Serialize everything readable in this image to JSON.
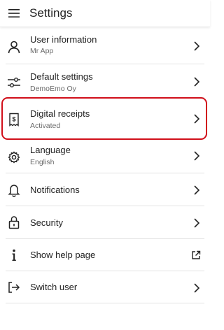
{
  "header": {
    "title": "Settings"
  },
  "items": [
    {
      "label": "User information",
      "sub": "Mr App",
      "icon": "person-icon",
      "trailing": "chevron-right-icon"
    },
    {
      "label": "Default settings",
      "sub": "DemoEmo Oy",
      "icon": "sliders-icon",
      "trailing": "chevron-right-icon"
    },
    {
      "label": "Digital receipts",
      "sub": "Activated",
      "icon": "receipt-icon",
      "trailing": "chevron-right-icon",
      "highlighted": true
    },
    {
      "label": "Language",
      "sub": "English",
      "icon": "gear-icon",
      "trailing": "chevron-right-icon"
    },
    {
      "label": "Notifications",
      "icon": "bell-icon",
      "trailing": "chevron-right-icon"
    },
    {
      "label": "Security",
      "icon": "lock-icon",
      "trailing": "chevron-right-icon"
    },
    {
      "label": "Show help page",
      "icon": "info-icon",
      "trailing": "external-link-icon"
    },
    {
      "label": "Switch user",
      "icon": "sign-in-icon",
      "trailing": "chevron-right-icon"
    }
  ],
  "colors": {
    "highlight_border": "#d10f1a",
    "text_primary": "#222222",
    "text_secondary": "#6b6b6b",
    "divider": "#e2e2e2"
  }
}
